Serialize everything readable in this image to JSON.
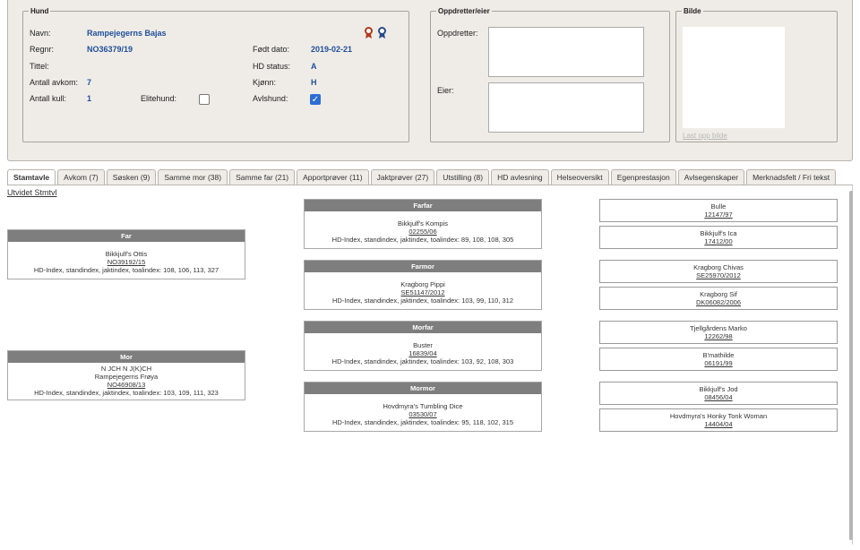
{
  "dog": {
    "legend": "Hund",
    "name_label": "Navn:",
    "name": "Rampejegerns Bajas",
    "regnr_label": "Regnr:",
    "regnr": "NO36379/19",
    "born_label": "Født dato:",
    "born": "2019-02-21",
    "title_label": "Tittel:",
    "hd_label": "HD status:",
    "hd": "A",
    "offspring_label": "Antall avkom:",
    "offspring": "7",
    "sex_label": "Kjønn:",
    "sex": "H",
    "litters_label": "Antall kull:",
    "litters": "1",
    "elite_label": "Elitehund:",
    "breeding_label": "Avlshund:"
  },
  "owner": {
    "legend": "Oppdretter/eier",
    "breeder_label": "Oppdretter:",
    "owner_label": "Eier:"
  },
  "picture": {
    "legend": "Bilde",
    "upload_label": "Last opp bilde"
  },
  "tabs": [
    "Stamtavle",
    "Avkom (7)",
    "Søsken (9)",
    "Samme mor (38)",
    "Samme far (21)",
    "Apportprøver (11)",
    "Jaktprøver (27)",
    "Utstilling (8)",
    "HD avlesning",
    "Helseoversikt",
    "Egenprestasjon",
    "Avlsegenskaper",
    "Merknadsfelt / Fri tekst"
  ],
  "pedigree": {
    "extended_link": "Utvidet Stmtvl",
    "far": {
      "header": "Far",
      "title": "",
      "name": "Bikkjulf's Ottis",
      "reg": "NO39192/15",
      "index": "HD-Index, standindex, jaktindex, toalindex: 108, 106, 113, 327"
    },
    "mor": {
      "header": "Mor",
      "title": "N JCH N J(K)CH",
      "name": "Rampejegerns Frøya",
      "reg": "NO46908/13",
      "index": "HD-Index, standindex, jaktindex, toalindex: 103, 109, 111, 323"
    },
    "farfar": {
      "header": "Farfar",
      "name": "Bikkjulf's Kompis",
      "reg": "02255/06",
      "index": "HD-Index, standindex, jaktindex, toalindex: 89, 108, 108, 305"
    },
    "farmor": {
      "header": "Farmor",
      "name": "Kragborg Pippi",
      "reg": "SE51147/2012",
      "index": "HD-Index, standindex, jaktindex, toalindex: 103, 99, 110, 312"
    },
    "morfar": {
      "header": "Morfar",
      "name": "Buster",
      "reg": "16839/04",
      "index": "HD-Index, standindex, jaktindex, toalindex: 103, 92, 108, 303"
    },
    "mormor": {
      "header": "Mormor",
      "name": "Hovdmyra's Tumbling Dice",
      "reg": "03530/07",
      "index": "HD-Index, standindex, jaktindex, toalindex: 95, 118, 102, 315"
    },
    "gen3": [
      {
        "name": "Bulle",
        "reg": "12147/97"
      },
      {
        "name": "Bikkjulf's Ica",
        "reg": "17412/00"
      },
      {
        "name": "Kragborg Chivas",
        "reg": "SE25970/2012"
      },
      {
        "name": "Kragborg Sif",
        "reg": "DK06082/2006"
      },
      {
        "name": "Tjellgårdens Marko",
        "reg": "12262/98"
      },
      {
        "name": "B'mathilde",
        "reg": "06191/99"
      },
      {
        "name": "Bikkjulf's Jod",
        "reg": "08456/04"
      },
      {
        "name": "Hovdmyra's Honky Tonk Woman",
        "reg": "14404/04"
      }
    ]
  },
  "colors": {
    "panel": "#efece7",
    "value": "#1f4e9c",
    "header": "#7e7e7e",
    "checkbox": "#2c6ed5"
  }
}
